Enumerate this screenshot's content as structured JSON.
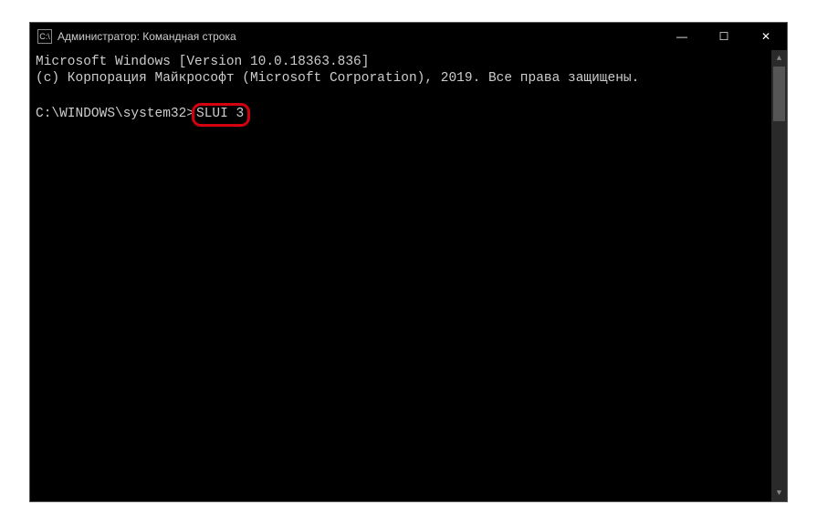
{
  "titlebar": {
    "icon_label": "C:\\",
    "title": "Администратор: Командная строка"
  },
  "window_controls": {
    "minimize": "—",
    "maximize": "☐",
    "close": "✕"
  },
  "terminal": {
    "line1": "Microsoft Windows [Version 10.0.18363.836]",
    "line2": "(c) Корпорация Майкрософт (Microsoft Corporation), 2019. Все права защищены.",
    "prompt": "C:\\WINDOWS\\system32>",
    "command": "SLUI 3"
  },
  "scrollbar": {
    "up": "▲",
    "down": "▼"
  }
}
